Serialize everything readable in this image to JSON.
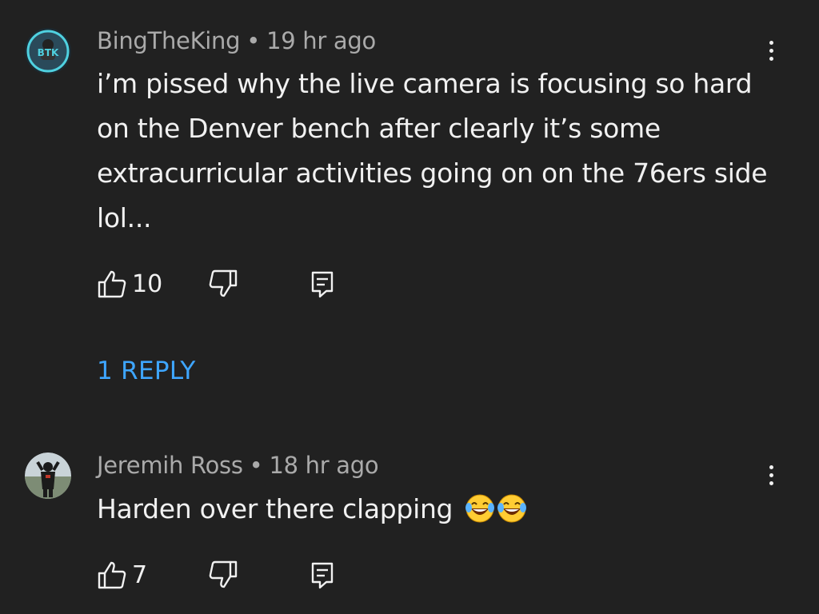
{
  "comments": [
    {
      "author": "BingTheKing",
      "separator": "•",
      "time": "19 hr ago",
      "text": "i’m pissed why the live camera is focusing so hard on the Denver bench after clearly it’s some extracurricular activities going on on the 76ers side lol...",
      "likes": "10",
      "avatar_text": "BTK",
      "avatar_colors": {
        "ring": "#4fd1e0",
        "bg": "#2a4a5a"
      }
    },
    {
      "author": "Jeremih Ross",
      "separator": "•",
      "time": "18 hr ago",
      "text": "Harden over there clapping",
      "emojis": [
        "😂",
        "😂"
      ],
      "likes": "7"
    }
  ],
  "reply_link": "1 REPLY",
  "icons": {
    "like": "thumbs-up-icon",
    "dislike": "thumbs-down-icon",
    "reply": "reply-comment-icon",
    "more": "more-vertical-icon"
  },
  "colors": {
    "background": "#212121",
    "link": "#3ea6ff",
    "meta": "#aaaaaa",
    "text": "#f1f1f1"
  }
}
